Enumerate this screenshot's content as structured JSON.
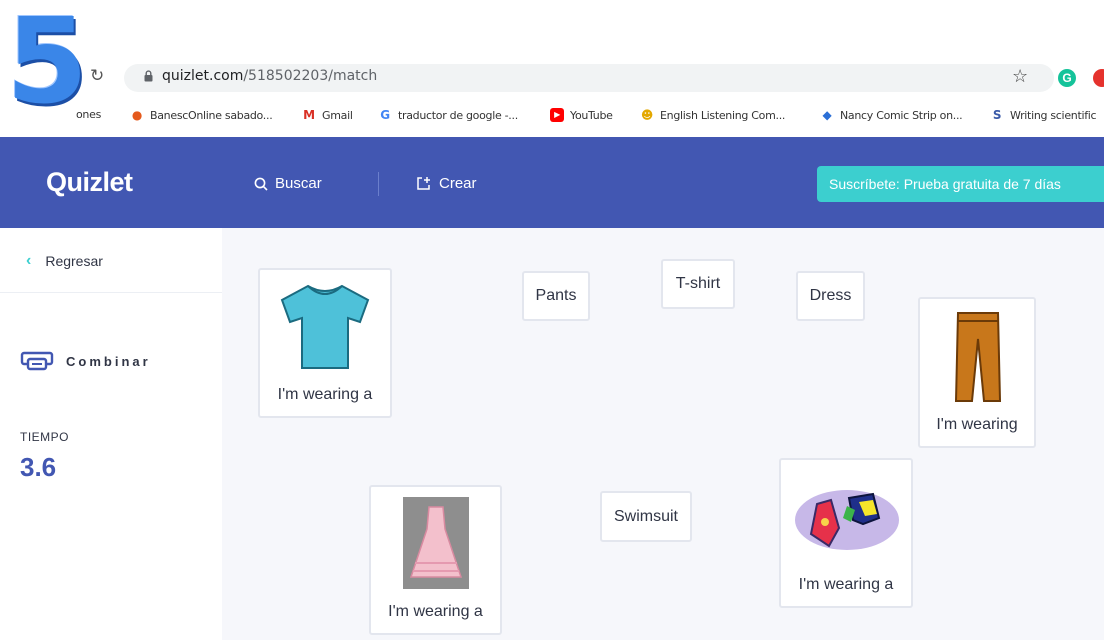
{
  "browser": {
    "badge_number": "5",
    "url_domain": "quizlet.com",
    "url_path": "/518502203/match",
    "bookmarks": [
      {
        "label": "ones",
        "icon": ""
      },
      {
        "label": "BanescOnline sabado...",
        "icon": "banesco-icon"
      },
      {
        "label": "Gmail",
        "icon": "gmail-icon"
      },
      {
        "label": "traductor de google -...",
        "icon": "google-icon"
      },
      {
        "label": "YouTube",
        "icon": "youtube-icon"
      },
      {
        "label": "English Listening Com...",
        "icon": "smiley-icon"
      },
      {
        "label": "Nancy Comic Strip on...",
        "icon": "shield-icon"
      },
      {
        "label": "Writing scientific",
        "icon": "link-icon"
      }
    ]
  },
  "header": {
    "logo": "Quizlet",
    "search_label": "Buscar",
    "create_label": "Crear",
    "subscribe_label": "Suscríbete: Prueba gratuita de 7 días"
  },
  "sidebar": {
    "back_label": "Regresar",
    "mode_label": "Combinar",
    "time_label": "TIEMPO",
    "time_value": "3.6"
  },
  "tiles": [
    {
      "id": "tshirt-image",
      "caption": "I'm wearing a",
      "image": "tshirt"
    },
    {
      "id": "pants",
      "label": "Pants"
    },
    {
      "id": "tshirt",
      "label": "T-shirt"
    },
    {
      "id": "dress",
      "label": "Dress"
    },
    {
      "id": "pants-image",
      "caption": "I'm wearing",
      "image": "pants"
    },
    {
      "id": "dress-image",
      "caption": "I'm wearing a",
      "image": "dress"
    },
    {
      "id": "swimsuit",
      "label": "Swimsuit"
    },
    {
      "id": "swimsuit-image",
      "caption": "I'm wearing a",
      "image": "swimsuit"
    }
  ],
  "colors": {
    "header_bg": "#4257b2",
    "accent": "#3ccfcf",
    "board_bg": "#f6f7fb"
  }
}
